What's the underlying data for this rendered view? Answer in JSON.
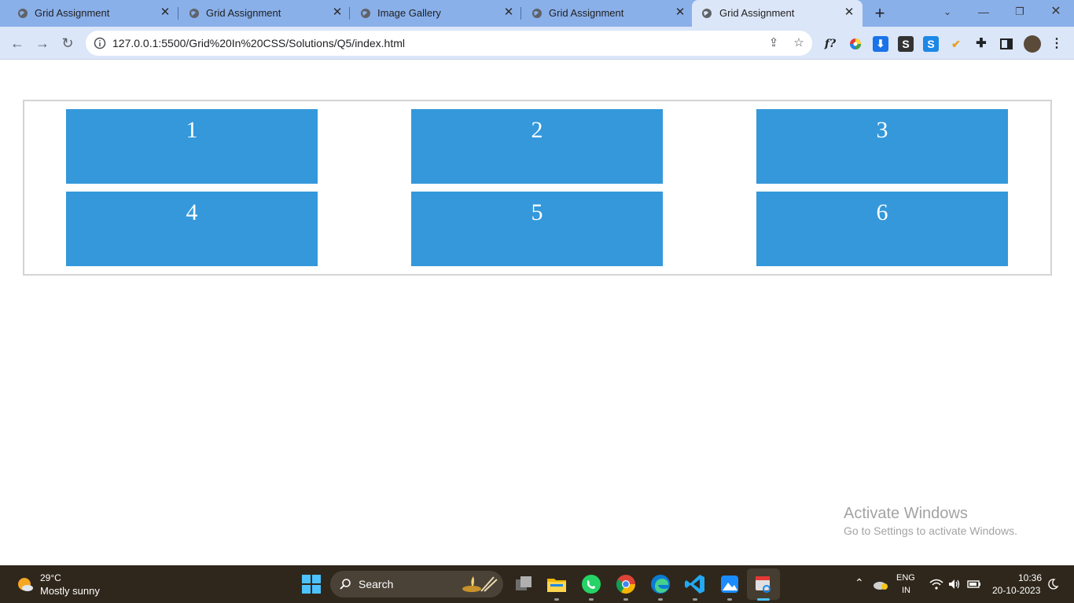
{
  "browser": {
    "tabs": [
      {
        "title": "Grid Assignment",
        "active": false
      },
      {
        "title": "Grid Assignment",
        "active": false
      },
      {
        "title": "Image Gallery",
        "active": false
      },
      {
        "title": "Grid Assignment",
        "active": false
      },
      {
        "title": "Grid Assignment",
        "active": true
      }
    ],
    "address": "127.0.0.1:5500/Grid%20In%20CSS/Solutions/Q5/index.html",
    "extensions": [
      "formula-icon",
      "color-wheel-icon",
      "download-icon",
      "s-icon",
      "s2-icon",
      "user-check-icon",
      "puzzle-icon",
      "sidepanel-icon",
      "profile-avatar",
      "menu-icon"
    ]
  },
  "page": {
    "items": [
      "1",
      "2",
      "3",
      "4",
      "5",
      "6"
    ],
    "item_color": "#3498db"
  },
  "watermark": {
    "title": "Activate Windows",
    "subtitle": "Go to Settings to activate Windows."
  },
  "taskbar": {
    "weather_temp": "29°C",
    "weather_desc": "Mostly sunny",
    "search_label": "Search",
    "language": "ENG",
    "region": "IN",
    "time": "10:36",
    "date": "20-10-2023"
  }
}
